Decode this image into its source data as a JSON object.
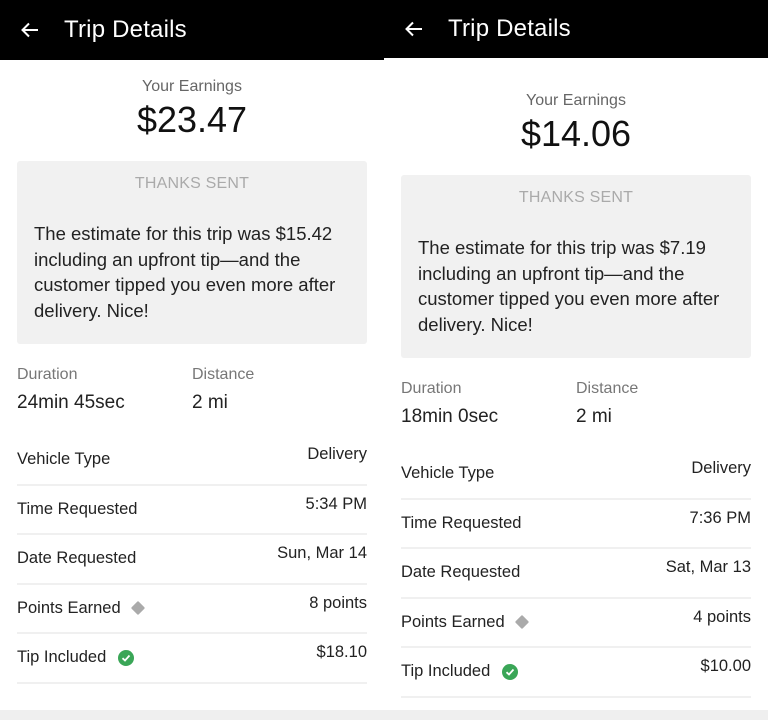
{
  "panels": [
    {
      "header": {
        "title": "Trip Details",
        "back_icon": "arrow-left-icon"
      },
      "earnings": {
        "label": "Your Earnings",
        "amount": "$23.47"
      },
      "thanks": {
        "title": "THANKS SENT",
        "message": "The estimate for this trip was $15.42 including an upfront tip—and the customer tipped you even more after delivery. Nice!"
      },
      "stats": [
        {
          "label": "Duration",
          "value": "24min 45sec"
        },
        {
          "label": "Distance",
          "value": "2 mi"
        }
      ],
      "rows": [
        {
          "label": "Vehicle Type",
          "value": "Delivery",
          "icon": ""
        },
        {
          "label": "Time Requested",
          "value": "5:34 PM",
          "icon": ""
        },
        {
          "label": "Date Requested",
          "value": "Sun, Mar 14",
          "icon": ""
        },
        {
          "label": "Points Earned",
          "value": "8 points",
          "icon": "diamond-icon"
        },
        {
          "label": "Tip Included",
          "value": "$18.10",
          "icon": "check-circle-icon"
        }
      ]
    },
    {
      "header": {
        "title": "Trip Details",
        "back_icon": "arrow-left-icon"
      },
      "earnings": {
        "label": "Your Earnings",
        "amount": "$14.06"
      },
      "thanks": {
        "title": "THANKS SENT",
        "message": "The estimate for this trip was $7.19 including an upfront tip—and the customer tipped you even more after delivery. Nice!"
      },
      "stats": [
        {
          "label": "Duration",
          "value": "18min 0sec"
        },
        {
          "label": "Distance",
          "value": "2 mi"
        }
      ],
      "rows": [
        {
          "label": "Vehicle Type",
          "value": "Delivery",
          "icon": ""
        },
        {
          "label": "Time Requested",
          "value": "7:36 PM",
          "icon": ""
        },
        {
          "label": "Date Requested",
          "value": "Sat, Mar 13",
          "icon": ""
        },
        {
          "label": "Points Earned",
          "value": "4 points",
          "icon": "diamond-icon"
        },
        {
          "label": "Tip Included",
          "value": "$10.00",
          "icon": "check-circle-icon"
        }
      ]
    }
  ],
  "colors": {
    "header_bg": "#000000",
    "thanks_bg": "#f1f1f1",
    "check_green": "#3aa657",
    "diamond_gray": "#aaaaaa"
  }
}
